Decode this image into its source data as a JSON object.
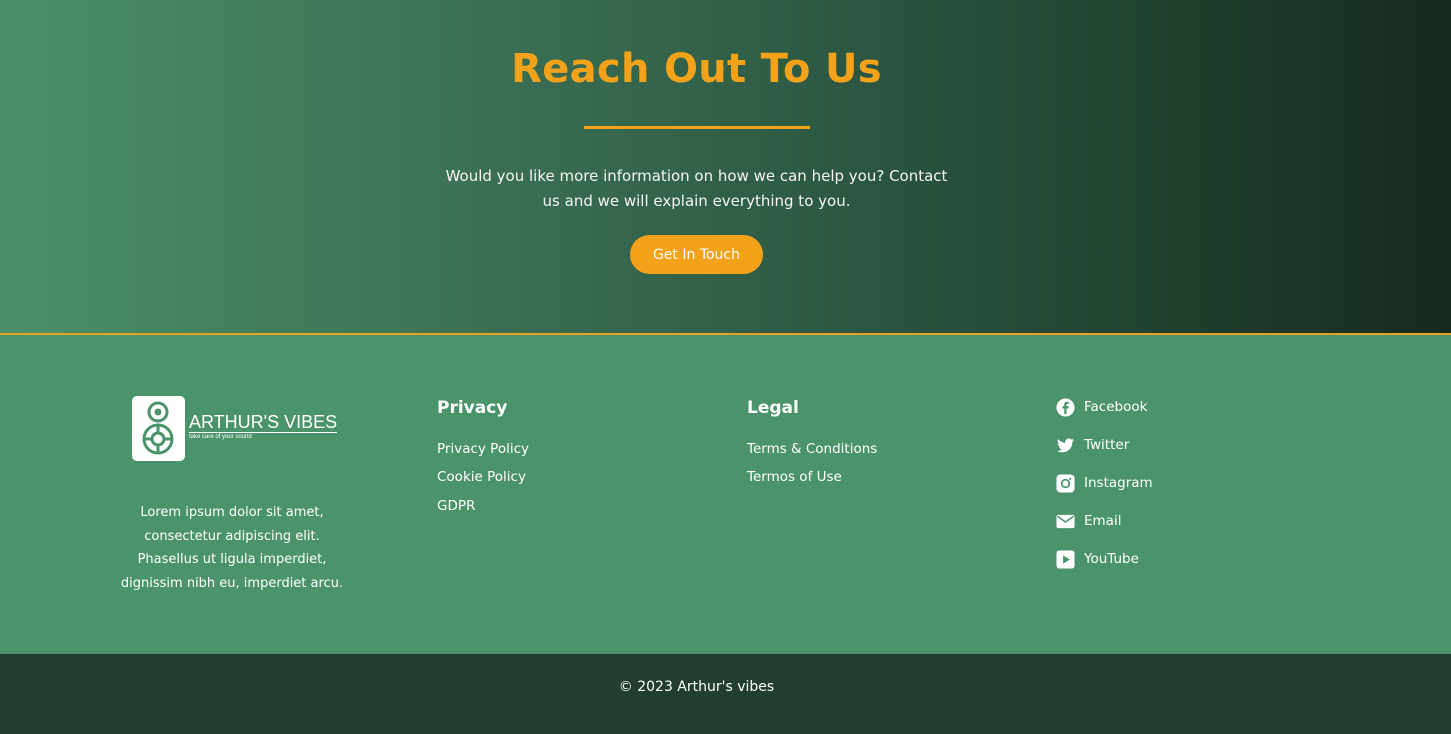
{
  "cta": {
    "title": "Reach Out To Us",
    "text": "Would you like more information on how we can help you? Contact us and we will explain everything to you.",
    "button_label": "Get In Touch"
  },
  "brand": {
    "name": "ARTHUR'S VIBES",
    "tagline": "take care of your sound",
    "about": "Lorem ipsum dolor sit amet, consectetur adipiscing elit. Phasellus ut ligula imperdiet, dignissim nibh eu, imperdiet arcu."
  },
  "privacy": {
    "heading": "Privacy",
    "links": [
      "Privacy Policy",
      "Cookie Policy",
      "GDPR"
    ]
  },
  "legal": {
    "heading": "Legal",
    "links": [
      "Terms & Conditions",
      "Termos of Use"
    ]
  },
  "social": [
    {
      "label": "Facebook",
      "icon": "facebook-icon"
    },
    {
      "label": "Twitter",
      "icon": "twitter-icon"
    },
    {
      "label": "Instagram",
      "icon": "instagram-icon"
    },
    {
      "label": "Email",
      "icon": "email-icon"
    },
    {
      "label": "YouTube",
      "icon": "youtube-icon"
    }
  ],
  "copyright": "© 2023  Arthur's vibes",
  "colors": {
    "accent": "#f4a21a",
    "footer_bg": "#4b946b",
    "bottom_bar_bg": "#223e30"
  }
}
